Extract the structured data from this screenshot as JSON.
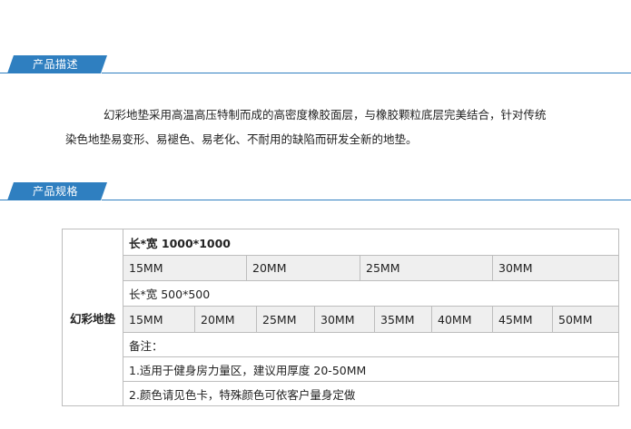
{
  "sections": {
    "description": {
      "heading": "产品描述",
      "text_line1": "幻彩地垫采用高温高压特制而成的高密度橡胶面层，与橡胶颗粒底层完美结合，针对传统",
      "text_line2": "染色地垫易变形、易褪色、易老化、不耐用的缺陷而研发全新的地垫。"
    },
    "spec": {
      "heading": "产品规格"
    }
  },
  "spec_table": {
    "product_name": "幻彩地垫",
    "size1_title": "长*宽  1000*1000",
    "size1_thicknesses": [
      "15MM",
      "20MM",
      "25MM",
      "30MM"
    ],
    "size2_title": "长*宽 500*500",
    "size2_thicknesses": [
      "15MM",
      "20MM",
      "25MM",
      "30MM",
      "35MM",
      "40MM",
      "45MM",
      "50MM"
    ],
    "notes_label": "备注：",
    "note1": "1.适用于健身房力量区，建议用厚度 20-50MM",
    "note2": "2.颜色请见色卡，特殊颜色可依客户量身定做"
  },
  "colors": {
    "accent": "#2f7fc0",
    "row_shade": "#efefef",
    "border": "#bdbdbd"
  }
}
